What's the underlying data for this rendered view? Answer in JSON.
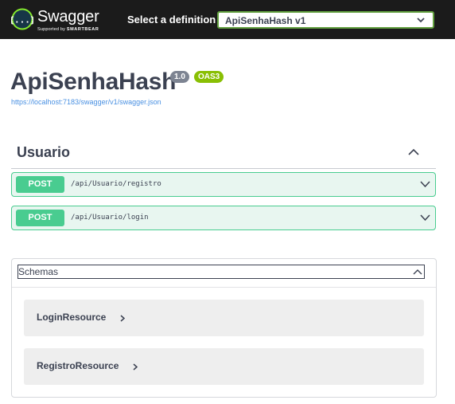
{
  "topbar": {
    "brand": "Swagger",
    "brand_sub_prefix": "Supported by",
    "brand_sub_company": "SMARTBEAR",
    "definition_label": "Select a definition",
    "definition_selected": "ApiSenhaHash v1"
  },
  "info": {
    "title": "ApiSenhaHash",
    "version": "1.0",
    "oas": "OAS3",
    "spec_url": "https://localhost:7183/swagger/v1/swagger.json"
  },
  "tag": {
    "name": "Usuario",
    "operations": [
      {
        "method": "POST",
        "path": "/api/Usuario/registro"
      },
      {
        "method": "POST",
        "path": "/api/Usuario/login"
      }
    ]
  },
  "schemas": {
    "title": "Schemas",
    "models": [
      {
        "name": "LoginResource"
      },
      {
        "name": "RegistroResource"
      }
    ]
  },
  "colors": {
    "topbar_bg": "#1b1b1b",
    "accent_green": "#89bf04",
    "post_green": "#49cc90",
    "post_bg": "#e8f6f0",
    "link_blue": "#4990e2"
  }
}
